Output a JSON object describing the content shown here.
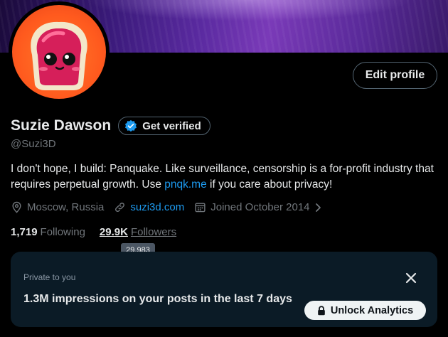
{
  "profile": {
    "name": "Suzie Dawson",
    "handle": "@Suzi3D",
    "verify_label": "Get verified",
    "edit_label": "Edit profile",
    "bio_part1": "I don't hope, I build: Panquake. Like surveillance, censorship is a for-profit industry that requires perpetual growth. Use ",
    "bio_link": "pnqk.me",
    "bio_part2": " if you care about privacy!",
    "location": "Moscow, Russia",
    "website": "suzi3d.com",
    "joined": "Joined October 2014",
    "following_count": "1,719",
    "following_label": "Following",
    "followers_count": "29.9K",
    "followers_label": "Followers",
    "followers_tooltip": "29,983"
  },
  "private_card": {
    "label": "Private to you",
    "text": "1.3M impressions on your posts in the last 7 days",
    "unlock_label": "Unlock Analytics"
  },
  "icons": [
    "location-icon",
    "link-icon",
    "calendar-icon",
    "chevron-right-icon",
    "verified-badge-icon",
    "close-icon",
    "lock-icon"
  ],
  "colors": {
    "accent": "#1d9bf0",
    "muted": "#71767b",
    "text": "#e7e9ea",
    "background": "#000000",
    "card": "#0b1b26"
  }
}
